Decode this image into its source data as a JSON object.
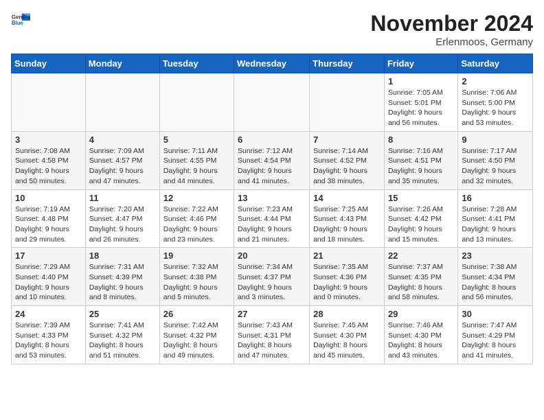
{
  "logo": {
    "general": "General",
    "blue": "Blue"
  },
  "title": "November 2024",
  "location": "Erlenmoos, Germany",
  "days_of_week": [
    "Sunday",
    "Monday",
    "Tuesday",
    "Wednesday",
    "Thursday",
    "Friday",
    "Saturday"
  ],
  "weeks": [
    {
      "days": [
        {
          "num": "",
          "info": ""
        },
        {
          "num": "",
          "info": ""
        },
        {
          "num": "",
          "info": ""
        },
        {
          "num": "",
          "info": ""
        },
        {
          "num": "",
          "info": ""
        },
        {
          "num": "1",
          "info": "Sunrise: 7:05 AM\nSunset: 5:01 PM\nDaylight: 9 hours and 56 minutes."
        },
        {
          "num": "2",
          "info": "Sunrise: 7:06 AM\nSunset: 5:00 PM\nDaylight: 9 hours and 53 minutes."
        }
      ]
    },
    {
      "days": [
        {
          "num": "3",
          "info": "Sunrise: 7:08 AM\nSunset: 4:58 PM\nDaylight: 9 hours and 50 minutes."
        },
        {
          "num": "4",
          "info": "Sunrise: 7:09 AM\nSunset: 4:57 PM\nDaylight: 9 hours and 47 minutes."
        },
        {
          "num": "5",
          "info": "Sunrise: 7:11 AM\nSunset: 4:55 PM\nDaylight: 9 hours and 44 minutes."
        },
        {
          "num": "6",
          "info": "Sunrise: 7:12 AM\nSunset: 4:54 PM\nDaylight: 9 hours and 41 minutes."
        },
        {
          "num": "7",
          "info": "Sunrise: 7:14 AM\nSunset: 4:52 PM\nDaylight: 9 hours and 38 minutes."
        },
        {
          "num": "8",
          "info": "Sunrise: 7:16 AM\nSunset: 4:51 PM\nDaylight: 9 hours and 35 minutes."
        },
        {
          "num": "9",
          "info": "Sunrise: 7:17 AM\nSunset: 4:50 PM\nDaylight: 9 hours and 32 minutes."
        }
      ]
    },
    {
      "days": [
        {
          "num": "10",
          "info": "Sunrise: 7:19 AM\nSunset: 4:48 PM\nDaylight: 9 hours and 29 minutes."
        },
        {
          "num": "11",
          "info": "Sunrise: 7:20 AM\nSunset: 4:47 PM\nDaylight: 9 hours and 26 minutes."
        },
        {
          "num": "12",
          "info": "Sunrise: 7:22 AM\nSunset: 4:46 PM\nDaylight: 9 hours and 23 minutes."
        },
        {
          "num": "13",
          "info": "Sunrise: 7:23 AM\nSunset: 4:44 PM\nDaylight: 9 hours and 21 minutes."
        },
        {
          "num": "14",
          "info": "Sunrise: 7:25 AM\nSunset: 4:43 PM\nDaylight: 9 hours and 18 minutes."
        },
        {
          "num": "15",
          "info": "Sunrise: 7:26 AM\nSunset: 4:42 PM\nDaylight: 9 hours and 15 minutes."
        },
        {
          "num": "16",
          "info": "Sunrise: 7:28 AM\nSunset: 4:41 PM\nDaylight: 9 hours and 13 minutes."
        }
      ]
    },
    {
      "days": [
        {
          "num": "17",
          "info": "Sunrise: 7:29 AM\nSunset: 4:40 PM\nDaylight: 9 hours and 10 minutes."
        },
        {
          "num": "18",
          "info": "Sunrise: 7:31 AM\nSunset: 4:39 PM\nDaylight: 9 hours and 8 minutes."
        },
        {
          "num": "19",
          "info": "Sunrise: 7:32 AM\nSunset: 4:38 PM\nDaylight: 9 hours and 5 minutes."
        },
        {
          "num": "20",
          "info": "Sunrise: 7:34 AM\nSunset: 4:37 PM\nDaylight: 9 hours and 3 minutes."
        },
        {
          "num": "21",
          "info": "Sunrise: 7:35 AM\nSunset: 4:36 PM\nDaylight: 9 hours and 0 minutes."
        },
        {
          "num": "22",
          "info": "Sunrise: 7:37 AM\nSunset: 4:35 PM\nDaylight: 8 hours and 58 minutes."
        },
        {
          "num": "23",
          "info": "Sunrise: 7:38 AM\nSunset: 4:34 PM\nDaylight: 8 hours and 56 minutes."
        }
      ]
    },
    {
      "days": [
        {
          "num": "24",
          "info": "Sunrise: 7:39 AM\nSunset: 4:33 PM\nDaylight: 8 hours and 53 minutes."
        },
        {
          "num": "25",
          "info": "Sunrise: 7:41 AM\nSunset: 4:32 PM\nDaylight: 8 hours and 51 minutes."
        },
        {
          "num": "26",
          "info": "Sunrise: 7:42 AM\nSunset: 4:32 PM\nDaylight: 8 hours and 49 minutes."
        },
        {
          "num": "27",
          "info": "Sunrise: 7:43 AM\nSunset: 4:31 PM\nDaylight: 8 hours and 47 minutes."
        },
        {
          "num": "28",
          "info": "Sunrise: 7:45 AM\nSunset: 4:30 PM\nDaylight: 8 hours and 45 minutes."
        },
        {
          "num": "29",
          "info": "Sunrise: 7:46 AM\nSunset: 4:30 PM\nDaylight: 8 hours and 43 minutes."
        },
        {
          "num": "30",
          "info": "Sunrise: 7:47 AM\nSunset: 4:29 PM\nDaylight: 8 hours and 41 minutes."
        }
      ]
    }
  ]
}
